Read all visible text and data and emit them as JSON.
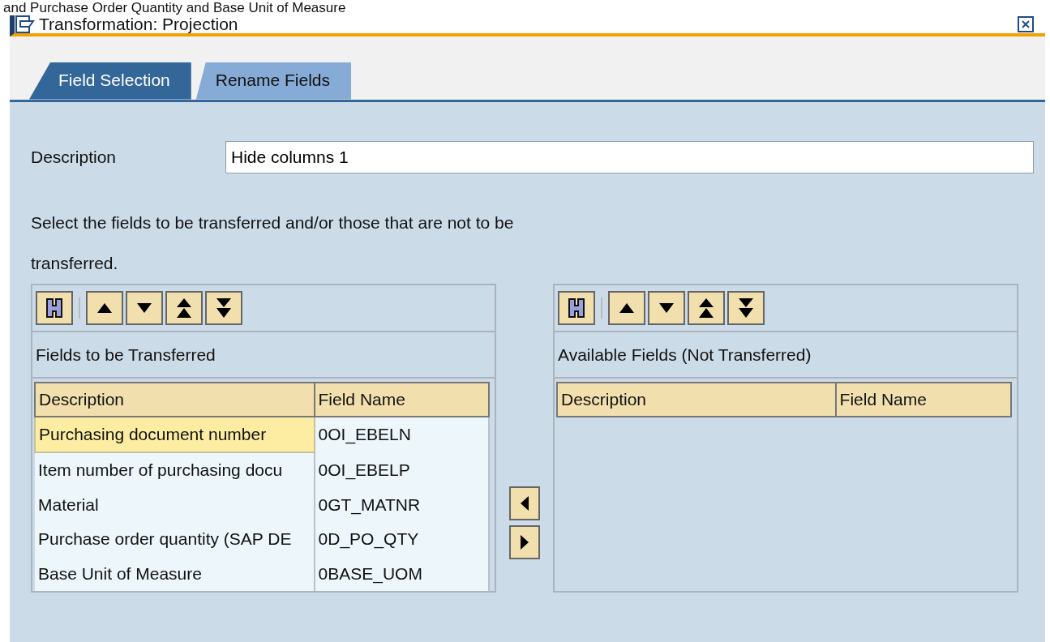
{
  "caption": "and Purchase Order Quantity and Base Unit of Measure",
  "window": {
    "title": "Transformation: Projection"
  },
  "tabs": [
    {
      "label": "Field Selection",
      "selected": true
    },
    {
      "label": "Rename Fields",
      "selected": false
    }
  ],
  "description": {
    "label": "Description",
    "value": "Hide columns 1"
  },
  "instructions": "Select the fields to be transferred and/or those that are not to be transferred.",
  "left_list": {
    "title": "Fields to be Transferred",
    "columns": [
      "Description",
      "Field Name"
    ],
    "rows": [
      {
        "cells": [
          "Purchasing document number",
          "0OI_EBELN"
        ],
        "selected": true
      },
      {
        "cells": [
          "Item number of purchasing docu",
          "0OI_EBELP"
        ],
        "selected": false
      },
      {
        "cells": [
          "Material",
          "0GT_MATNR"
        ],
        "selected": false
      },
      {
        "cells": [
          "Purchase order quantity (SAP DE",
          "0D_PO_QTY"
        ],
        "selected": false
      },
      {
        "cells": [
          "Base Unit of Measure",
          "0BASE_UOM"
        ],
        "selected": false
      }
    ]
  },
  "right_list": {
    "title": "Available Fields (Not Transferred)",
    "columns": [
      "Description",
      "Field Name"
    ]
  }
}
